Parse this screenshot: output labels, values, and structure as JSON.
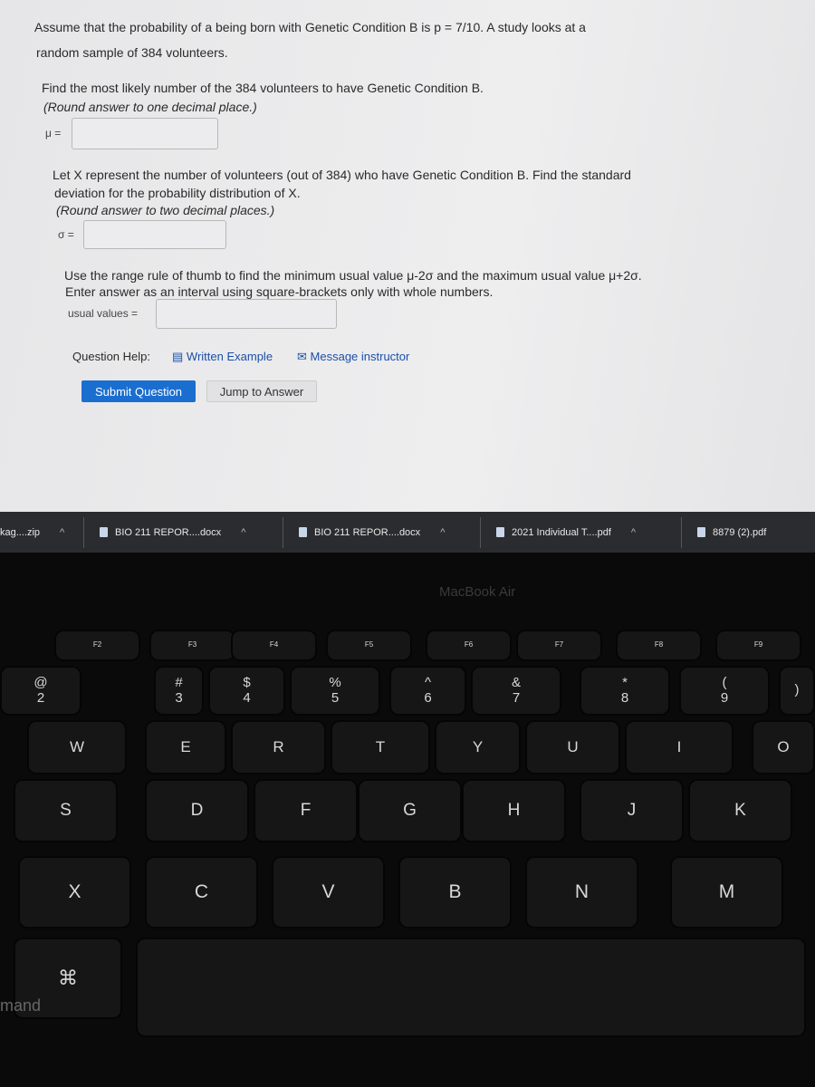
{
  "question": {
    "intro_line1": "Assume that the probability of a being born with Genetic Condition B is p = 7/10. A study looks at a",
    "intro_line2": "random sample of 384 volunteers.",
    "q1_line1": "Find the most likely number of the 384 volunteers to have Genetic Condition B.",
    "q1_line2": "(Round answer to one decimal place.)",
    "mu_label": "μ =",
    "mu_value": "",
    "q2_line1": "Let X represent the number of volunteers (out of 384) who have Genetic Condition B. Find the standard",
    "q2_line2": "deviation for the probability distribution of X.",
    "q2_line3": "(Round answer to two decimal places.)",
    "sigma_label": "σ =",
    "sigma_value": "",
    "q3_line1": "Use the range rule of thumb to find the minimum usual value μ-2σ and the maximum usual value μ+2σ.",
    "q3_line2": "Enter answer as an interval using square-brackets only with whole numbers.",
    "usual_label": "usual values =",
    "usual_value": "",
    "help_label": "Question Help:",
    "written_example": "Written Example",
    "message_instructor": "Message instructor",
    "submit": "Submit Question",
    "jump": "Jump to Answer"
  },
  "downloads": [
    {
      "name": "kag....zip"
    },
    {
      "name": "BIO 211 REPOR....docx"
    },
    {
      "name": "BIO 211 REPOR....docx"
    },
    {
      "name": "2021 Individual T....pdf"
    },
    {
      "name": "8879 (2).pdf"
    }
  ],
  "chevron": "^",
  "laptop_brand": "MacBook Air",
  "keyboard": {
    "fn_row": [
      "F2",
      "F3",
      "F4",
      "F5",
      "F6",
      "F7",
      "F8",
      "F9"
    ],
    "num_row": [
      "@\n2",
      "#\n3",
      "$\n4",
      "%\n5",
      "^\n6",
      "&\n7",
      "*\n8",
      "(\n9",
      ")"
    ],
    "q_row": [
      "W",
      "E",
      "R",
      "T",
      "Y",
      "U",
      "I",
      "O"
    ],
    "a_row": [
      "S",
      "D",
      "F",
      "G",
      "H",
      "J",
      "K"
    ],
    "z_row": [
      "X",
      "C",
      "V",
      "B",
      "N",
      "M"
    ],
    "cmd_symbol": "⌘",
    "cmd_text": "mand"
  }
}
